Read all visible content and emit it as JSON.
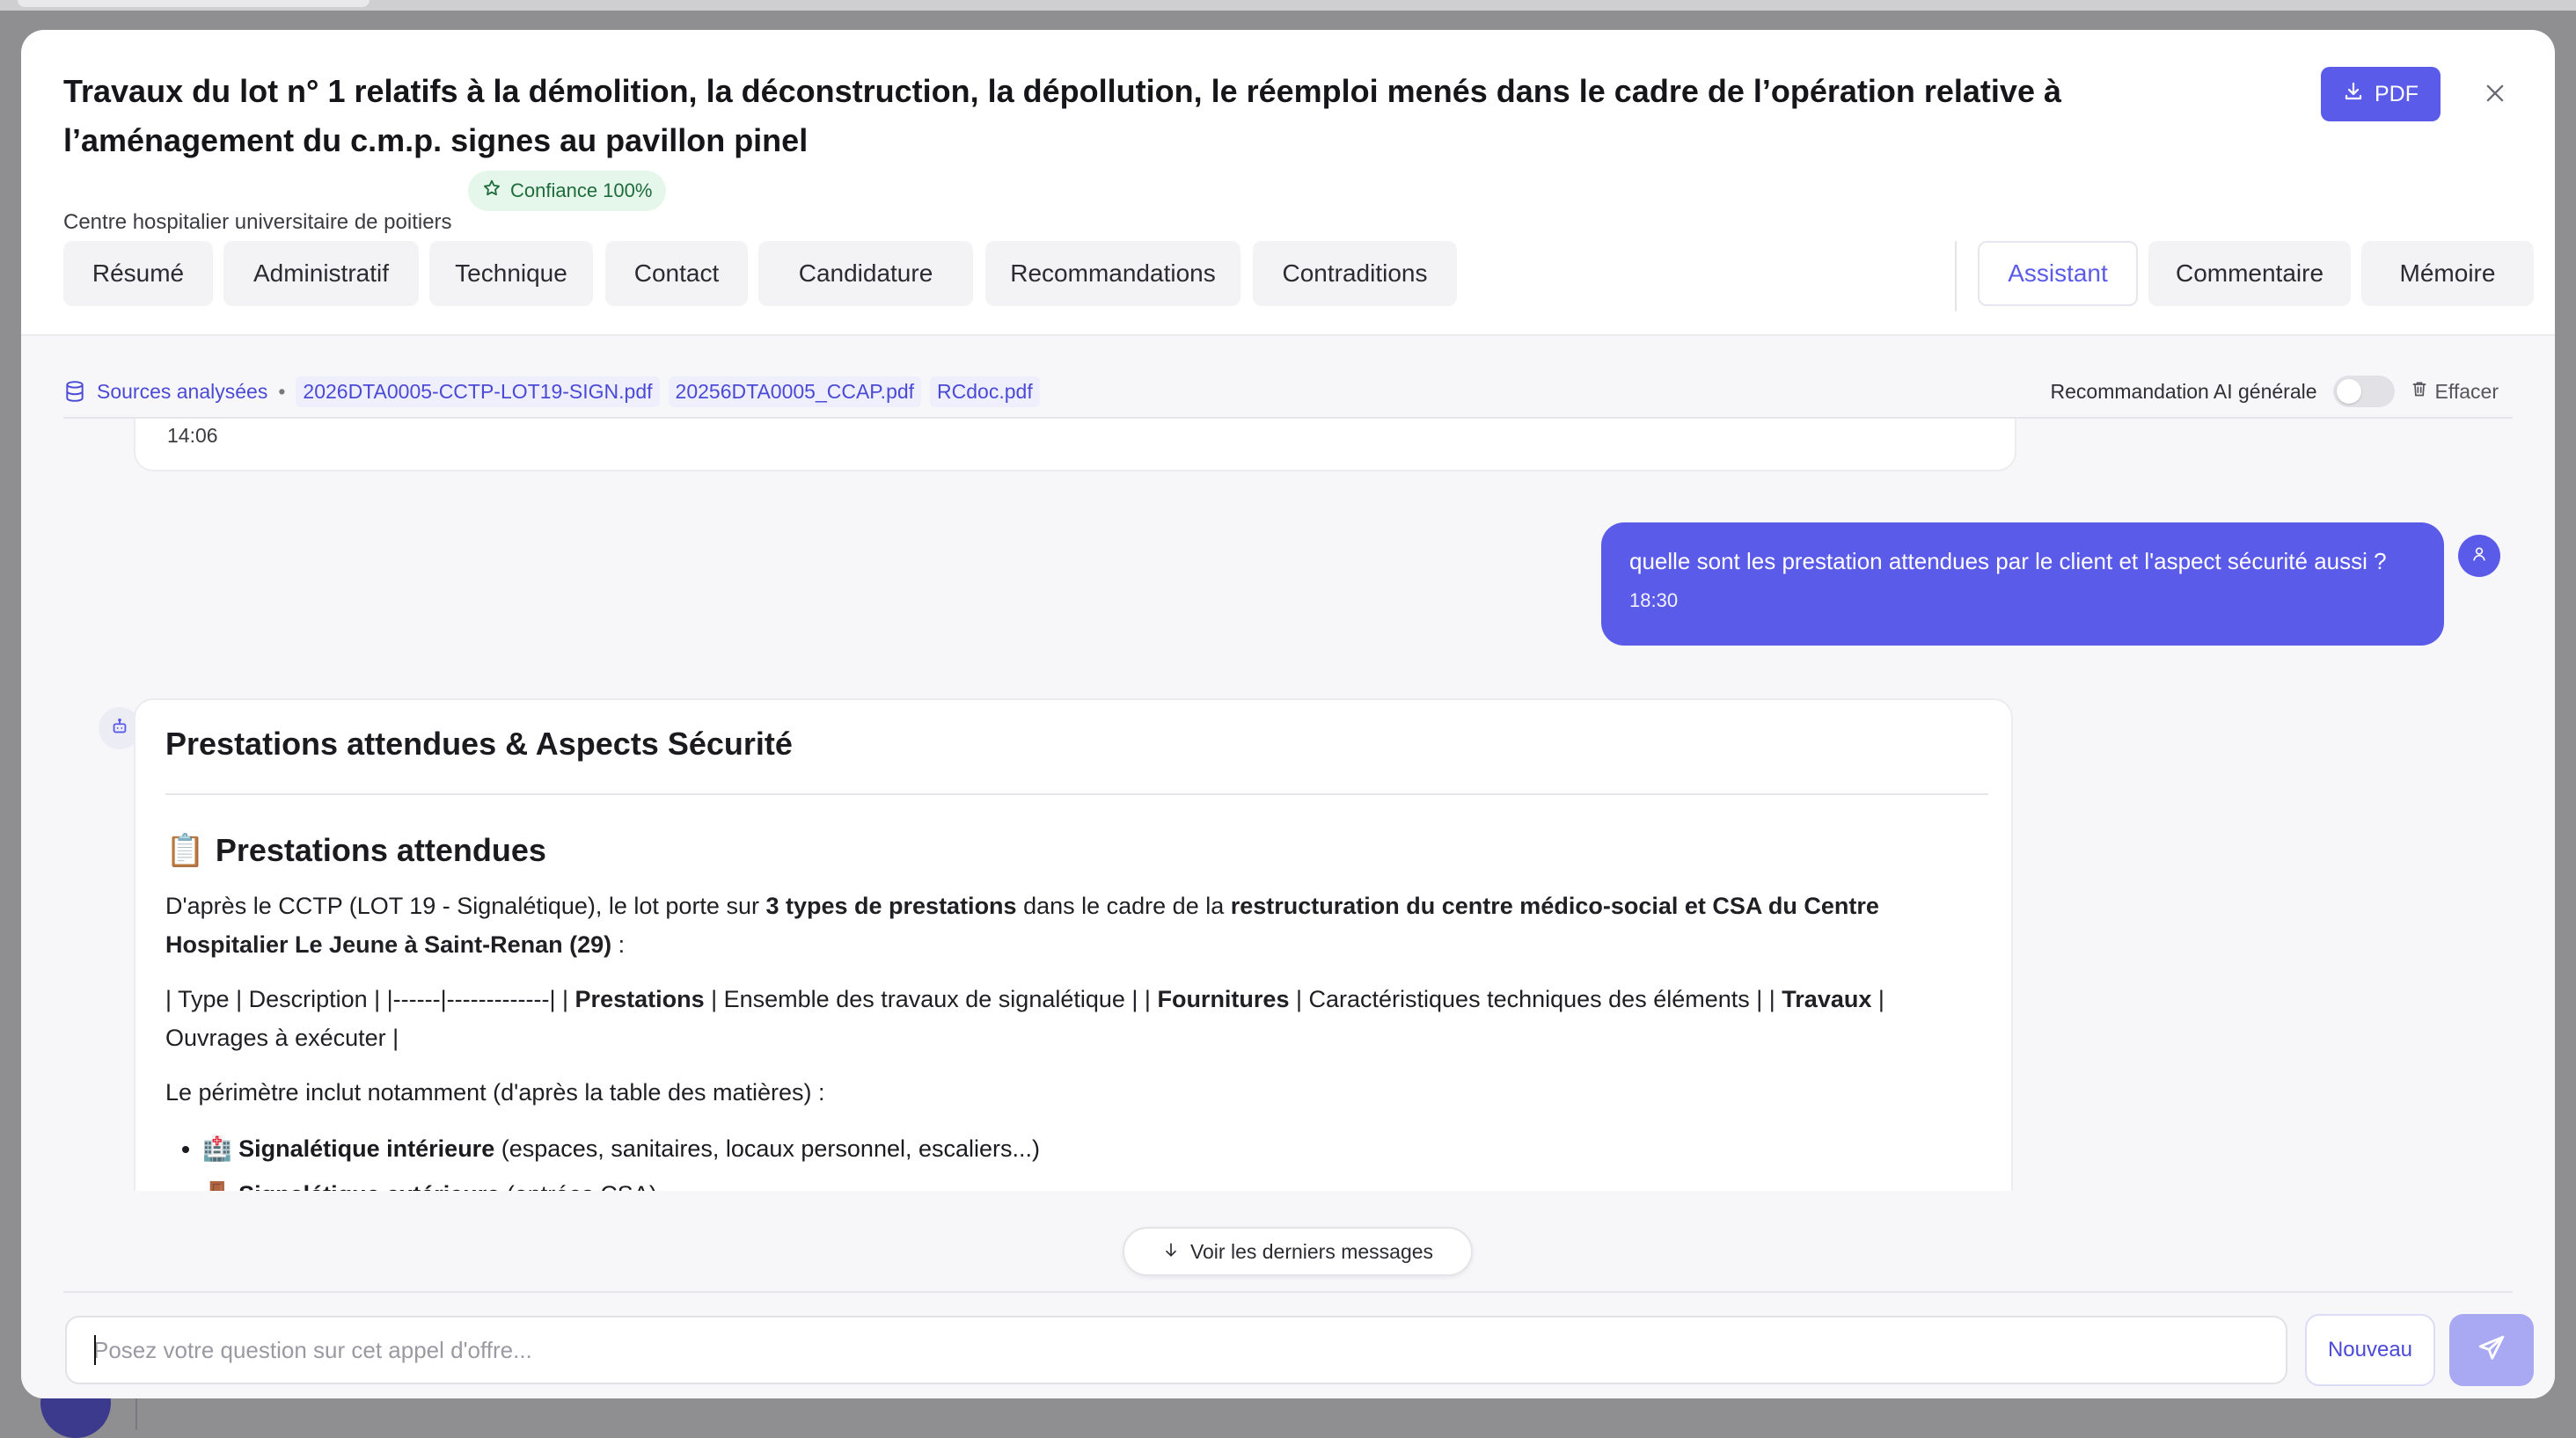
{
  "modal": {
    "title": "Travaux du lot n° 1 relatifs à la démolition, la déconstruction, la dépollution, le réemploi menés dans le cadre de l’opération relative à l’aménagement du c.m.p. signes au pavillon pinel",
    "buyer": "Centre hospitalier universitaire de poitiers",
    "confidence_badge": "Confiance 100%",
    "pdf_label": "PDF"
  },
  "tabs": {
    "left": [
      "Résumé",
      "Administratif",
      "Technique",
      "Contact",
      "Candidature",
      "Recommandations",
      "Contraditions"
    ],
    "right": [
      "Assistant",
      "Commentaire",
      "Mémoire"
    ],
    "active": "Assistant"
  },
  "sources": {
    "label": "Sources analysées",
    "separator": "•",
    "files": [
      "2026DTA0005-CCTP-LOT19-SIGN.pdf",
      "20256DTA0005_CCAP.pdf",
      "RCdoc.pdf"
    ],
    "recommendation_label": "Recommandation AI générale",
    "recommendation_enabled": false,
    "clear_label": "Effacer"
  },
  "messages": {
    "previous_time": "14:06",
    "user": {
      "text": "quelle sont les prestation attendues par le client et l'aspect sécurité aussi ?",
      "time": "18:30"
    },
    "bot": {
      "heading": "Prestations attendues & Aspects Sécurité",
      "subheading_emoji": "📋",
      "subheading": "Prestations attendues",
      "p1_a": "D'après le CCTP (LOT 19 - Signalétique), le lot porte sur ",
      "p1_b": "3 types de prestations",
      "p1_c": " dans le cadre de la ",
      "p1_d": "restructuration du centre médico-social et CSA du Centre Hospitalier Le Jeune à Saint-Renan (29)",
      "p1_e": " :",
      "table_a": "| Type | Description | |------|-------------| | ",
      "table_b": "Prestations",
      "table_c": " | Ensemble des travaux de signalétique | | ",
      "table_d": "Fournitures",
      "table_e": " | Caractéristiques techniques des éléments | | ",
      "table_f": "Travaux",
      "table_g": " | Ouvrages à exécuter |",
      "p3": "Le périmètre inclut notamment (d'après la table des matières) :",
      "list": [
        {
          "emoji": "🏥",
          "bold": "Signalétique intérieure",
          "rest": " (espaces, sanitaires, locaux personnel, escaliers...)"
        },
        {
          "emoji": "🚪",
          "bold": "Signalétique extérieure",
          "rest": " (entrées CSA)"
        }
      ]
    }
  },
  "scroll_button_label": "Voir les derniers messages",
  "composer": {
    "placeholder": "Posez votre question sur cet appel d'offre...",
    "value": "",
    "new_label": "Nouveau"
  },
  "colors": {
    "accent": "#5b5bea",
    "accent_light": "#a9a9f3",
    "badge_bg": "#e4f7ea",
    "badge_text": "#1f6b3c"
  }
}
